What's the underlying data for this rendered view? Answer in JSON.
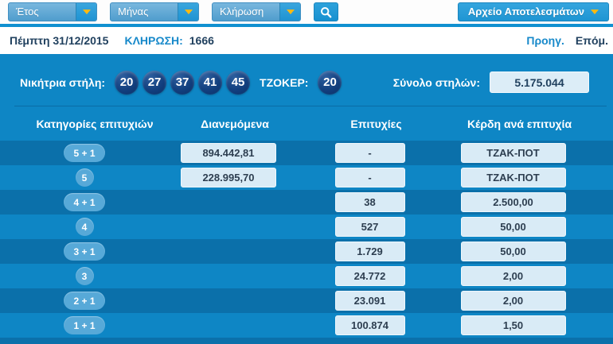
{
  "toolbar": {
    "dropdowns": [
      {
        "label": "Έτος"
      },
      {
        "label": "Μήνας"
      },
      {
        "label": "Κλήρωση"
      }
    ],
    "search_icon": "magnifier-icon",
    "archive_button": "Αρχείο Αποτελεσμάτων"
  },
  "draw_bar": {
    "date": "Πέμπτη 31/12/2015",
    "draw_label": "ΚΛΗΡΩΣΗ:",
    "draw_number": "1666",
    "prev_link": "Προηγ.",
    "next_link": "Επόμ."
  },
  "results": {
    "winning_label": "Νικήτρια στήλη:",
    "numbers": [
      "20",
      "27",
      "37",
      "41",
      "45"
    ],
    "joker_label": "ΤΖΟΚΕΡ:",
    "joker_number": "20",
    "columns_label": "Σύνολο στηλών:",
    "columns_total": "5.175.044"
  },
  "table": {
    "headers": [
      "Κατηγορίες επιτυχιών",
      "Διανεμόμενα",
      "Επιτυχίες",
      "Κέρδη ανά επιτυχία"
    ],
    "rows": [
      {
        "category": "5 + 1",
        "distributed": "894.442,81",
        "winners": "-",
        "prize": "ΤΖΑΚ-ΠΟΤ",
        "shade": "dark"
      },
      {
        "category": "5",
        "distributed": "228.995,70",
        "winners": "-",
        "prize": "ΤΖΑΚ-ΠΟΤ",
        "shade": "light"
      },
      {
        "category": "4 + 1",
        "distributed": "",
        "winners": "38",
        "prize": "2.500,00",
        "shade": "dark"
      },
      {
        "category": "4",
        "distributed": "",
        "winners": "527",
        "prize": "50,00",
        "shade": "light"
      },
      {
        "category": "3 + 1",
        "distributed": "",
        "winners": "1.729",
        "prize": "50,00",
        "shade": "dark"
      },
      {
        "category": "3",
        "distributed": "",
        "winners": "24.772",
        "prize": "2,00",
        "shade": "light"
      },
      {
        "category": "2 + 1",
        "distributed": "",
        "winners": "23.091",
        "prize": "2,00",
        "shade": "dark"
      },
      {
        "category": "1 + 1",
        "distributed": "",
        "winners": "100.874",
        "prize": "1,50",
        "shade": "light"
      }
    ]
  },
  "colors": {
    "main_blue": "#0e86c5",
    "dark_row_blue": "#0b70aa",
    "ball_navy": "#123f7e",
    "accent_link_blue": "#1789ca",
    "dark_navy_text": "#21415f",
    "caret_yellow": "#fdb913",
    "light_value_box": "#d9ebf6"
  }
}
